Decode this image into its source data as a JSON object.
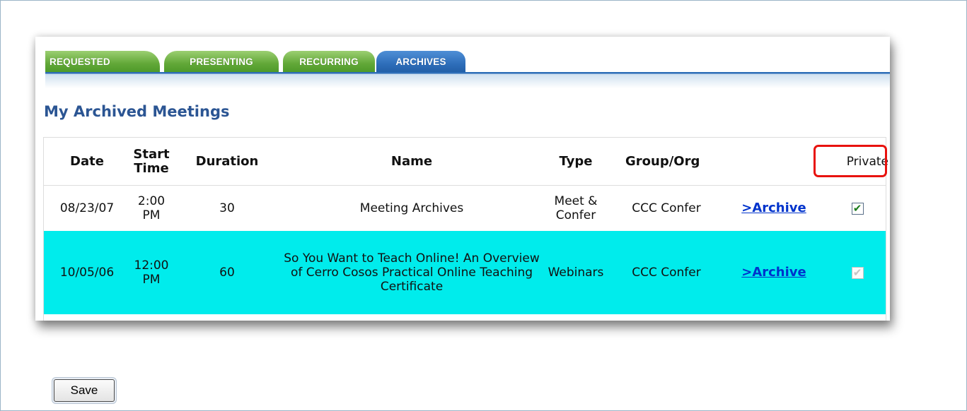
{
  "tabs": [
    {
      "label": "REQUESTED",
      "active": false
    },
    {
      "label": "PRESENTING",
      "active": false
    },
    {
      "label": "RECURRING",
      "active": false
    },
    {
      "label": "ARCHIVES",
      "active": true
    }
  ],
  "section_title": "My Archived Meetings",
  "table": {
    "headers": {
      "date": "Date",
      "start_time": "Start Time",
      "duration": "Duration",
      "name": "Name",
      "type": "Type",
      "group_org": "Group/Org",
      "private": "Private"
    },
    "rows": [
      {
        "date": "08/23/07",
        "start_time": "2:00 PM",
        "duration": "30",
        "name": "Meeting Archives",
        "type": "Meet & Confer",
        "group_org": "CCC Confer",
        "archive_link": ">Archive",
        "private_checked": true,
        "private_enabled": true
      },
      {
        "date": "10/05/06",
        "start_time": "12:00 PM",
        "duration": "60",
        "name": "So You Want to Teach Online! An Overview of Cerro Cosos Practical Online Teaching Certificate",
        "type": "Webinars",
        "group_org": "CCC Confer",
        "archive_link": ">Archive",
        "private_checked": true,
        "private_enabled": false
      }
    ]
  },
  "save_label": "Save",
  "colors": {
    "tab_green": "#62a838",
    "tab_blue_active": "#2f6fbb",
    "title_blue": "#2b5593",
    "row_highlight": "#00ecec",
    "link_blue": "#0033cc",
    "callout_red": "#e8120e"
  },
  "icons": {
    "checkbox_checked": "check-icon"
  }
}
